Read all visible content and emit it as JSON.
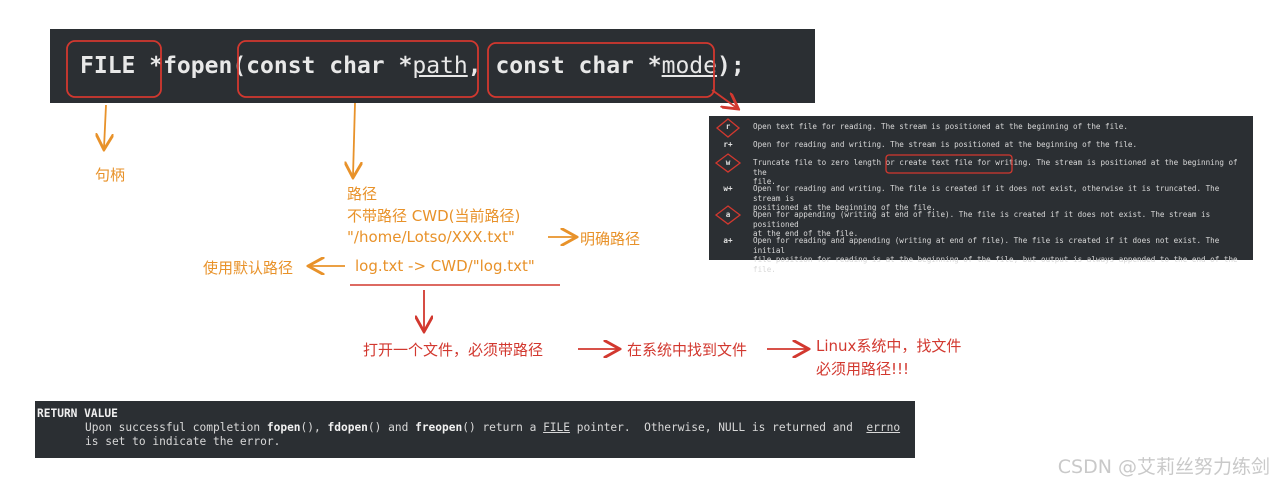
{
  "code": {
    "p1": "FILE",
    "p2": " *fopen(",
    "p3": "const char *",
    "p4": "path",
    "p5": ", ",
    "p6": "const char *",
    "p7": "mode",
    "p8": ");"
  },
  "annotations": {
    "handle": "句柄",
    "path_title": "路径",
    "path_line1": "不带路径 CWD(当前路径)",
    "path_line2": "\"/home/Lotso/XXX.txt\"",
    "explicit_path": "明确路径",
    "default_path": "使用默认路径",
    "log_example": "log.txt -> CWD/\"log.txt\"",
    "flow_step1": "打开一个文件，必须带路径",
    "flow_step2": "在系统中找到文件",
    "flow_step3a": "Linux系统中，找文件",
    "flow_step3b": "必须用路径!!!"
  },
  "modes": [
    {
      "mode": "r",
      "lines": [
        "Open text file for reading.  The stream is positioned at the beginning of the file."
      ]
    },
    {
      "mode": "r+",
      "lines": [
        "Open for reading and writing.  The stream is positioned at the beginning of the file."
      ]
    },
    {
      "mode": "w",
      "lines": [
        "Truncate file to zero length or create text file for writing.  The stream is positioned at the  beginning  of  the",
        "file."
      ]
    },
    {
      "mode": "w+",
      "lines": [
        "Open for reading and writing.  The file is created if it does not exist, otherwise it is truncated.  The stream is",
        "positioned at the beginning of the file."
      ]
    },
    {
      "mode": "a",
      "lines": [
        "Open for appending (writing at end of file).  The file is created if it does not exist.  The stream is  positioned",
        "at the end of the file."
      ]
    },
    {
      "mode": "a+",
      "lines": [
        "Open  for  reading and appending (writing at end of file).  The file is created if it does not exist.  The initial",
        "file position for reading is at the beginning of the file, but output is always appended to the end of the file."
      ]
    }
  ],
  "return_value": {
    "title": "RETURN VALUE",
    "l1_a": "Upon successful completion ",
    "l1_b": "fopen",
    "l1_c": "(), ",
    "l1_d": "fdopen",
    "l1_e": "() and ",
    "l1_f": "freopen",
    "l1_g": "() return a ",
    "l1_h": "FILE",
    "l1_i": " pointer.  Otherwise, NULL is returned and  ",
    "l1_j": "errno",
    "l2": "is set to indicate the error."
  },
  "watermark": "CSDN @艾莉丝努力练剑",
  "colors": {
    "orange": "#e8922a",
    "red": "#d2382f",
    "panel": "#2b2f33"
  }
}
